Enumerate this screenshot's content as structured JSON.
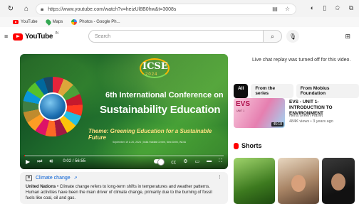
{
  "browser": {
    "url": "https://www.youtube.com/watch?v=heizUl8B0hw&t=3008s",
    "bookmarks": [
      {
        "label": "YouTube",
        "icon": "youtube-icon"
      },
      {
        "label": "Maps",
        "icon": "maps-pin-icon"
      },
      {
        "label": "Photos - Google Ph...",
        "icon": "photos-icon"
      }
    ]
  },
  "header": {
    "logo_text": "YouTube",
    "country_code": "IN",
    "search_placeholder": "Search"
  },
  "video": {
    "logo_title": "ICSE",
    "logo_year": "2024",
    "line1": "6th International Conference on",
    "line2": "Sustainability Education",
    "theme": "Theme: Greening Education for a Sustainable Future",
    "venue": "September 19 & 20, 2024 | India Habitat Centre, New Delhi, INDIA",
    "timecode": "0:02 / 56:55",
    "progress_fraction": 0.001
  },
  "description": {
    "title": "Climate change",
    "org": "United Nations",
    "text": " • Climate change refers to long-term shifts in temperatures and weather patterns. Human activities have been the main driver of climate change, primarily due to the burning of fossil fuels like coal, oil and gas."
  },
  "sidebar": {
    "chat_note": "Live chat replay was turned off for this video.",
    "chips": [
      "All",
      "From the series",
      "From Mobius Foundation"
    ],
    "recommendation": {
      "thumb_title": "EVS",
      "thumb_sub": "UNIT 1",
      "duration": "45:18",
      "title": "EVS - UNIT 1- INTRODUCTION TO ENVIRONMENT",
      "channel": "Neha Green Planet",
      "meta": "484K views • 3 years ago"
    },
    "shorts_label": "Shorts"
  }
}
